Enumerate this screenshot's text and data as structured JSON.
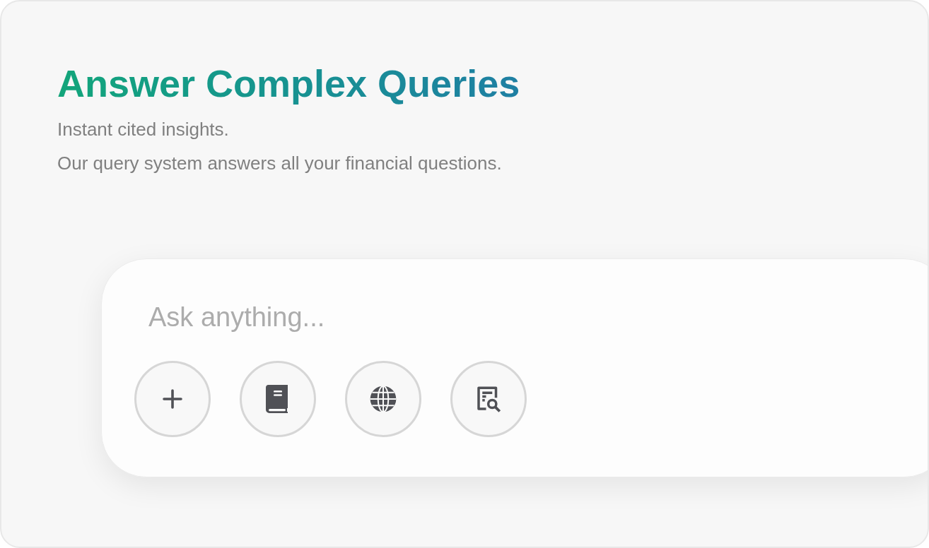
{
  "header": {
    "title": "Answer Complex Queries",
    "lines": [
      "Instant cited insights.",
      "Our query system answers all your financial questions."
    ]
  },
  "query_box": {
    "placeholder": "Ask anything...",
    "buttons": [
      {
        "kind": "plus"
      },
      {
        "kind": "book"
      },
      {
        "kind": "globe"
      },
      {
        "kind": "document-search"
      }
    ]
  }
}
